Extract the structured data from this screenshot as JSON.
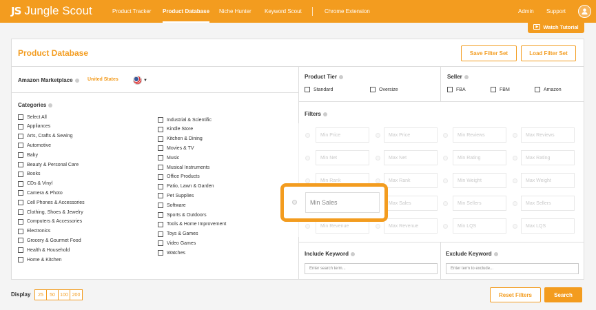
{
  "brand": {
    "mark": "JS",
    "name": "Jungle Scout"
  },
  "nav": {
    "items": [
      "Product Tracker",
      "Product Database",
      "Niche Hunter",
      "Keyword Scout",
      "Chrome Extension"
    ],
    "admin": "Admin",
    "support": "Support"
  },
  "tutorial": {
    "label": "Watch Tutorial"
  },
  "page": {
    "title": "Product Database",
    "save_filter_set": "Save Filter Set",
    "load_filter_set": "Load Filter Set"
  },
  "marketplace": {
    "label": "Amazon Marketplace",
    "value": "United States"
  },
  "categories": {
    "label": "Categories",
    "left": [
      "Select All",
      "Appliances",
      "Arts, Crafts & Sewing",
      "Automotive",
      "Baby",
      "Beauty & Personal Care",
      "Books",
      "CDs & Vinyl",
      "Camera & Photo",
      "Cell Phones & Accessories",
      "Clothing, Shoes & Jewelry",
      "Computers & Accessories",
      "Electronics",
      "Grocery & Gourmet Food",
      "Health & Household",
      "Home & Kitchen"
    ],
    "right": [
      "Industrial & Scientific",
      "Kindle Store",
      "Kitchen & Dining",
      "Movies & TV",
      "Music",
      "Musical Instruments",
      "Office Products",
      "Patio, Lawn & Garden",
      "Pet Supplies",
      "Software",
      "Sports & Outdoors",
      "Tools & Home Improvement",
      "Toys & Games",
      "Video Games",
      "Watches"
    ]
  },
  "product_tier": {
    "label": "Product Tier",
    "options": [
      "Standard",
      "Oversize"
    ]
  },
  "seller": {
    "label": "Seller",
    "options": [
      "FBA",
      "FBM",
      "Amazon"
    ]
  },
  "filters": {
    "label": "Filters",
    "rows": [
      [
        "Min Price",
        "Max Price",
        "Min Reviews",
        "Max Reviews"
      ],
      [
        "Min Net",
        "Max Net",
        "Min Rating",
        "Max Rating"
      ],
      [
        "Min Rank",
        "Max Rank",
        "Min Weight",
        "Max Weight"
      ],
      [
        "Min Sales",
        "Max Sales",
        "Min Sellers",
        "Max Sellers"
      ],
      [
        "Min Revenue",
        "Max Revenue",
        "Min LQS",
        "Max LQS"
      ]
    ]
  },
  "include_keyword": {
    "label": "Include Keyword",
    "placeholder": "Enter search term..."
  },
  "exclude_keyword": {
    "label": "Exclude Keyword",
    "placeholder": "Enter term to exclude..."
  },
  "footer": {
    "display_label": "Display",
    "page_sizes": [
      "25",
      "50",
      "100",
      "200"
    ],
    "reset": "Reset Filters",
    "search": "Search"
  },
  "colors": {
    "accent": "#f39c1f"
  },
  "icons": {
    "info": "info-icon",
    "avatar": "user-icon",
    "play": "play-icon"
  }
}
